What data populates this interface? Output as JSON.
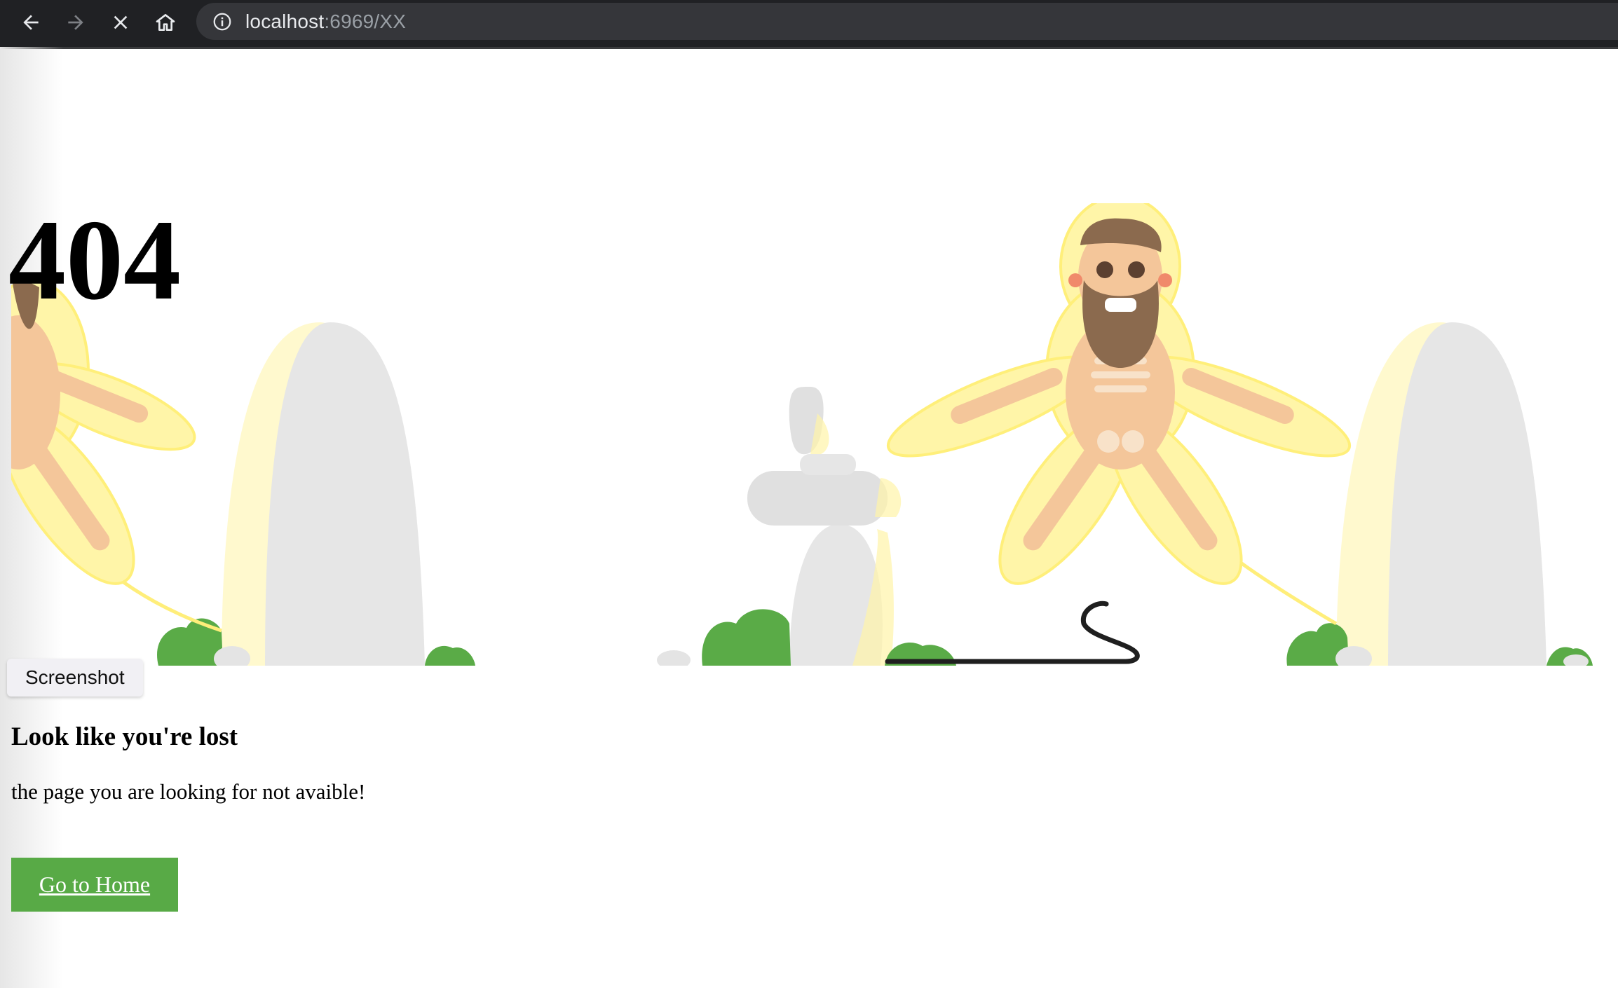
{
  "browser": {
    "url_host": "localhost",
    "url_rest": ":6969/XX",
    "icons": [
      "back-arrow-icon",
      "forward-arrow-icon",
      "stop-loading-icon",
      "home-icon",
      "site-info-icon"
    ]
  },
  "page": {
    "error_code": "404",
    "screenshot_tag": "Screenshot",
    "heading": "Look like you're lost",
    "message": "the page you are looking for not avaible!",
    "home_button": "Go to Home"
  },
  "colors": {
    "toolbar": "#202124",
    "button_green": "#58aa46",
    "bush_green": "#5aab47",
    "rock_gray": "#e4e4e4",
    "glow_yellow": "#fff3a6"
  }
}
